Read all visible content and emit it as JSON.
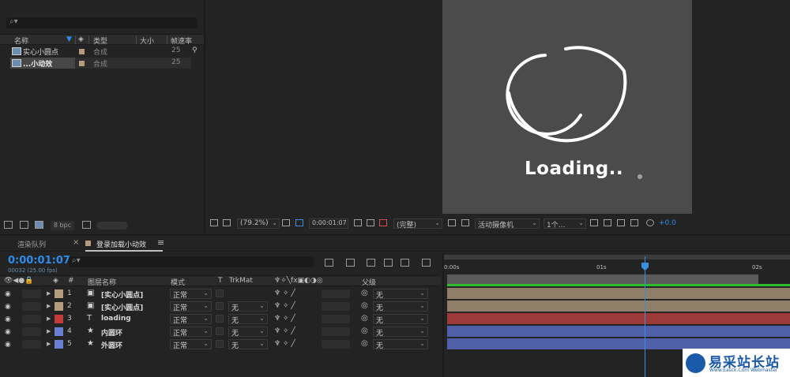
{
  "project": {
    "search_icon": "search-icon",
    "columns": {
      "name": "名称",
      "type": "类型",
      "size": "大小",
      "fps": "帧速率"
    },
    "items": [
      {
        "name": "实心小圆点",
        "type": "合成",
        "fps": "25"
      },
      {
        "name": "...小动效",
        "type": "合成",
        "fps": "25"
      }
    ],
    "footer": {
      "bpc": "8 bpc"
    }
  },
  "viewer": {
    "canvas_color": "#4b4b4b",
    "loading_text": "Loading..",
    "toolbar": {
      "zoom": "(79.2%)",
      "timecode": "0:00:01:07",
      "resolution": "(完整)",
      "camera": "活动摄像机",
      "views": "1个...",
      "exposure": "+0.0"
    }
  },
  "timeline": {
    "tabs": {
      "render_queue": "渲染队列",
      "close": "×",
      "comp": "登录加载小动效",
      "menu": "≡"
    },
    "timecode": "0:00:01:07",
    "frame_info": "00032 (25.00 fps)",
    "headers": {
      "num": "#",
      "layer_name": "图层名称",
      "mode": "模式",
      "t": "T",
      "trkmat": "TrkMat",
      "parent": "父级"
    },
    "layers": [
      {
        "num": "1",
        "name": "[实心小圆点]",
        "mode": "正常",
        "trkmat": "",
        "parent": "无",
        "label_color": "#b49c7d",
        "type_icon": "comp-icon",
        "bar_color": "#8f7f68"
      },
      {
        "num": "2",
        "name": "[实心小圆点]",
        "mode": "正常",
        "trkmat": "无",
        "parent": "无",
        "label_color": "#b49c7d",
        "type_icon": "comp-icon",
        "bar_color": "#8f7f68"
      },
      {
        "num": "3",
        "name": "loading",
        "mode": "正常",
        "trkmat": "无",
        "parent": "无",
        "label_color": "#c13b3b",
        "type_icon": "text-icon",
        "bar_color": "#9c3a3a"
      },
      {
        "num": "4",
        "name": "内圆环",
        "mode": "正常",
        "trkmat": "无",
        "parent": "无",
        "label_color": "#6a7fd4",
        "type_icon": "shape-star-icon",
        "bar_color": "#5060a8"
      },
      {
        "num": "5",
        "name": "外圆环",
        "mode": "正常",
        "trkmat": "无",
        "parent": "无",
        "label_color": "#6a7fd4",
        "type_icon": "shape-star-icon",
        "bar_color": "#5060a8"
      }
    ],
    "ruler": {
      "start": "0:00s",
      "mid": "01s",
      "end": "02s"
    },
    "playhead_time_s": 1.28
  },
  "watermark": {
    "text": "易采站长站",
    "sub": "Www.Easck.Com Webmaster"
  }
}
